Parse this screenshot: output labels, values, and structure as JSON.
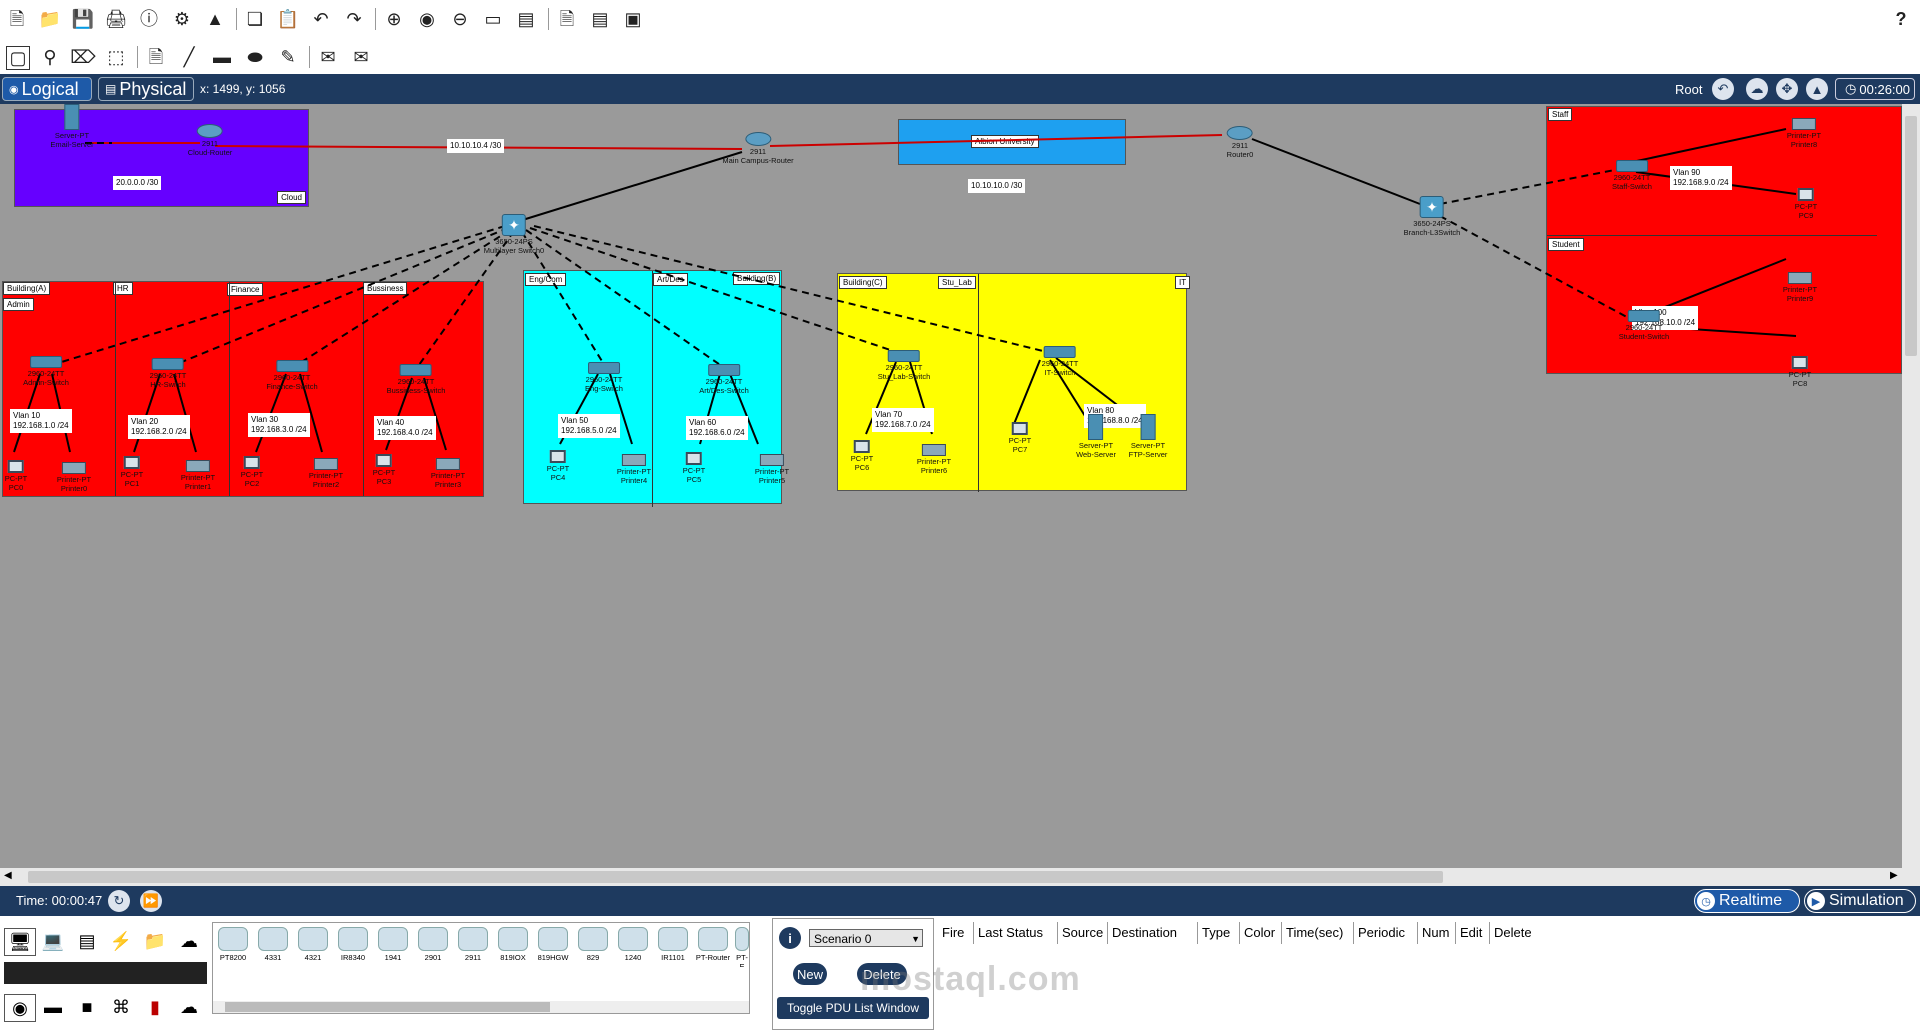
{
  "toolbar": {
    "icons": [
      "new-file",
      "open-folder",
      "save",
      "print",
      "info",
      "wizard",
      "activity",
      "copy",
      "paste",
      "undo",
      "redo",
      "zoom-in",
      "zoom-reset",
      "zoom-out",
      "rectangle",
      "palette",
      "notes",
      "cluster",
      "viewport"
    ],
    "help": "?"
  },
  "tools": [
    "select",
    "inspect",
    "delete",
    "resize",
    "note",
    "line",
    "rectangle",
    "ellipse",
    "freeform",
    "simple-pdu",
    "complex-pdu"
  ],
  "tabs": {
    "logical": "Logical",
    "physical": "Physical"
  },
  "coords": "x: 1499, y: 1056",
  "root": "Root",
  "clock": "00:26:00",
  "areas": {
    "cloud": "Cloud",
    "building_a": "Building(A)",
    "admin": "Admin",
    "hr": "HR",
    "finance": "Finance",
    "business": "Bussiness",
    "engcom": "Eng/Com",
    "artdes": "Art/Des",
    "building_b": "Building(B)",
    "building_c": "Building(C)",
    "stu_lab": "Stu_Lab",
    "it": "IT",
    "staff": "Staff",
    "student": "Student",
    "albion": "Albion University"
  },
  "notes": {
    "net_cloud": "20.0.0.0 /30",
    "link1": "10.10.10.4 /30",
    "link2": "10.10.10.0 /30",
    "vlan10": "Vlan 10\n192.168.1.0 /24",
    "vlan20": "Vlan 20\n192.168.2.0 /24",
    "vlan30": "Vlan 30\n192.168.3.0 /24",
    "vlan40": "Vlan 40\n192.168.4.0 /24",
    "vlan50": "Vlan 50\n192.168.5.0 /24",
    "vlan60": "Vlan 60\n192.168.6.0 /24",
    "vlan70": "Vlan 70\n192.168.7.0 /24",
    "vlan80": "Vlan 80\n192.168.8.0 /24",
    "vlan90": "Vlan 90\n192.168.9.0 /24",
    "vlan100": "Vlan 100\n192.168.10.0 /24"
  },
  "devices": {
    "email_server": "Server-PT\nEmail-Server",
    "cloud_router": "2911\nCloud-Router",
    "main_router": "2911\nMain Campus-Router",
    "router0": "2911\nRouter0",
    "mls0": "3650-24PS\nMultilayer Switch0",
    "branch_l3": "3650-24PS\nBranch-L3Switch",
    "admin_sw": "2960-24TT\nAdmin-Switch",
    "hr_sw": "2960-24TT\nHR-Switch",
    "fin_sw": "2960-24TT\nFinance-Switch",
    "bus_sw": "2960-24TT\nBussiness-Switch",
    "eng_sw": "2960-24TT\nEng-Switch",
    "art_sw": "2960-24TT\nArt/Des-Switch",
    "stu_sw": "2960-24TT\nStu_Lab-Switch",
    "it_sw": "2960-24TT\nIT-Switch",
    "staff_sw": "2960-24TT\nStaff-Switch",
    "student_sw": "2960-24TT\nStudent-Switch",
    "pc0": "PC-PT\nPC0",
    "pc1": "PC-PT\nPC1",
    "pc2": "PC-PT\nPC2",
    "pc3": "PC-PT\nPC3",
    "pc4": "PC-PT\nPC4",
    "pc5": "PC-PT\nPC5",
    "pc6": "PC-PT\nPC6",
    "pc7": "PC-PT\nPC7",
    "pc8": "PC-PT\nPC8",
    "pc9": "PC-PT\nPC9",
    "printer0": "Printer-PT\nPrinter0",
    "printer1": "Printer-PT\nPrinter1",
    "printer2": "Printer-PT\nPrinter2",
    "printer3": "Printer-PT\nPrinter3",
    "printer4": "Printer-PT\nPrinter4",
    "printer5": "Printer-PT\nPrinter5",
    "printer6": "Printer-PT\nPrinter6",
    "printer8": "Printer-PT\nPrinter8",
    "printer9": "Printer-PT\nPrinter9",
    "web_server": "Server-PT\nWeb-Server",
    "ftp_server": "Server-PT\nFTP-Server"
  },
  "bottom": {
    "time": "Time: 00:00:47",
    "realtime": "Realtime",
    "simulation": "Simulation"
  },
  "device_list": [
    "PT8200",
    "4331",
    "4321",
    "IR8340",
    "1941",
    "2901",
    "2911",
    "819IOX",
    "819HGW",
    "829",
    "1240",
    "IR1101",
    "PT-Router",
    "PT-E"
  ],
  "scenario": {
    "selected": "Scenario 0",
    "new": "New",
    "delete": "Delete",
    "toggle": "Toggle PDU List Window"
  },
  "pdu_columns": [
    "Fire",
    "Last Status",
    "Source",
    "Destination",
    "Type",
    "Color",
    "Time(sec)",
    "Periodic",
    "Num",
    "Edit",
    "Delete"
  ],
  "watermark": "mostaql.com",
  "colors": {
    "accent": "#1e3a5f",
    "canvas": "#9a9a9a",
    "red_zone": "#ff0000",
    "cyan_zone": "#00ffff",
    "yellow_zone": "#ffff00",
    "purple_zone": "#6600ff",
    "blue_zone": "#1ea0f0"
  }
}
